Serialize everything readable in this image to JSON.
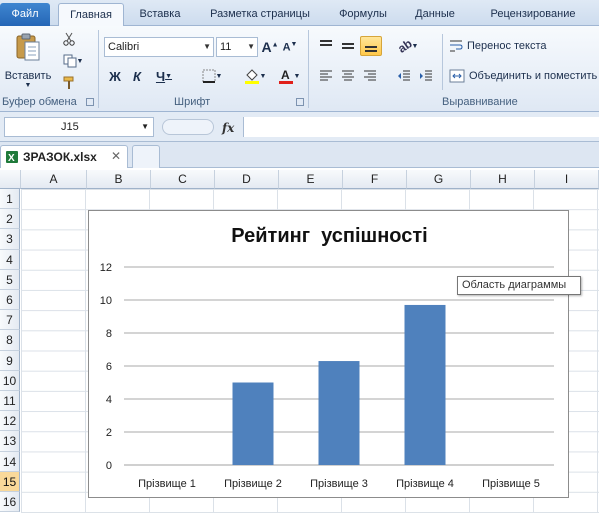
{
  "ribbon_tabs": [
    "Файл",
    "Главная",
    "Вставка",
    "Разметка страницы",
    "Формулы",
    "Данные",
    "Рецензирование"
  ],
  "clipboard": {
    "paste_label": "Вставить",
    "group_label": "Буфер обмена"
  },
  "font": {
    "name": "Calibri",
    "size": "11",
    "group_label": "Шрифт",
    "bold": "Ж",
    "italic": "К",
    "underline": "Ч"
  },
  "alignment": {
    "wrap_label": "Перенос текста",
    "merge_label": "Объединить и поместить",
    "group_label": "Выравнивание"
  },
  "formula_bar": {
    "cell_ref": "J15",
    "fx": "fx",
    "value": ""
  },
  "document": {
    "filename": "ЗРАЗОК.xlsx"
  },
  "columns": [
    "A",
    "B",
    "C",
    "D",
    "E",
    "F",
    "G",
    "H",
    "I"
  ],
  "rows": [
    "1",
    "2",
    "3",
    "4",
    "5",
    "6",
    "7",
    "8",
    "9",
    "10",
    "11",
    "12",
    "13",
    "14",
    "15",
    "16"
  ],
  "selected_row": "15",
  "tooltip": "Область диаграммы",
  "colors": {
    "bar": "#4f81bd",
    "accent": "#2a6ebb"
  },
  "chart_data": {
    "type": "bar",
    "title": "Рейтинг  успішності",
    "categories": [
      "Прізвище 1",
      "Прізвище 2",
      "Прізвище 3",
      "Прізвище 4",
      "Прізвище 5"
    ],
    "values": [
      0,
      5,
      6.3,
      9.7,
      0
    ],
    "ylim": [
      0,
      12
    ],
    "yticks": [
      "0",
      "2",
      "4",
      "6",
      "8",
      "10",
      "12"
    ],
    "grid": true
  }
}
